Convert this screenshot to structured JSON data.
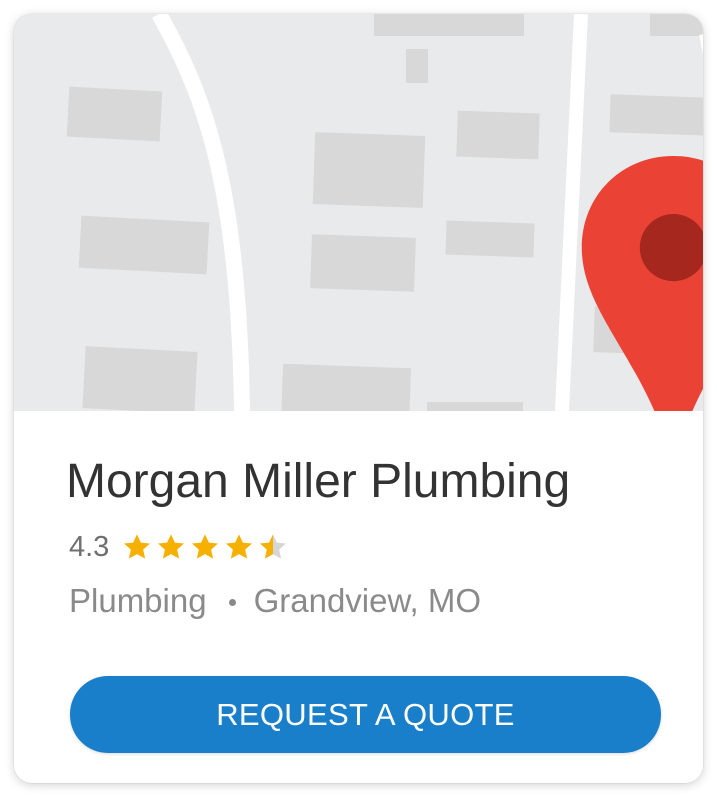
{
  "map": {
    "pin_icon": "map-pin-icon",
    "colors": {
      "background": "#e9eaeb",
      "building": "#d8d8d8",
      "road": "#ffffff",
      "pin": "#ea4335",
      "pin_dot": "#a5271e"
    }
  },
  "business": {
    "name": "Morgan Miller Plumbing",
    "rating": "4.3",
    "rating_value": 4.3,
    "stars_max": 5,
    "category": "Plumbing",
    "location": "Grandview, MO"
  },
  "cta": {
    "label": "REQUEST A QUOTE",
    "color": "#1a7fcb"
  },
  "colors": {
    "star_filled": "#f6b000",
    "star_empty": "#d6d6d6",
    "title_text": "#333333",
    "secondary_text": "#8a8a8a"
  }
}
